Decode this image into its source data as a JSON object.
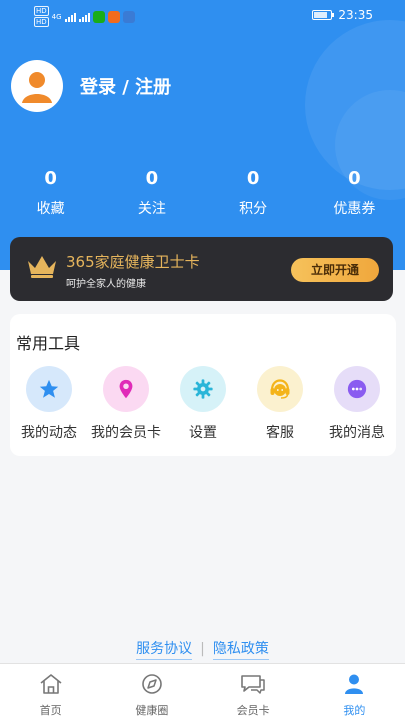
{
  "status_bar": {
    "time": "23:35",
    "sim_tags": [
      "HD",
      "HD"
    ],
    "network": "4G",
    "app_icons": [
      "wechat-icon",
      "video-icon",
      "browser-icon"
    ],
    "battery_level": 0.8,
    "colors": {
      "wechat": "#1aad19",
      "video": "#f26b1d",
      "browser": "#3a7bd5"
    }
  },
  "user": {
    "login_label": "登录 / 注册"
  },
  "stats": [
    {
      "value": "0",
      "label": "收藏"
    },
    {
      "value": "0",
      "label": "关注"
    },
    {
      "value": "0",
      "label": "积分"
    },
    {
      "value": "0",
      "label": "优惠券"
    }
  ],
  "vip_card": {
    "title": "365家庭健康卫士卡",
    "subtitle": "呵护全家人的健康",
    "button": "立即开通"
  },
  "tools": {
    "heading": "常用工具",
    "items": [
      {
        "label": "我的动态",
        "icon": "star-icon",
        "bg": "#d6e8fb",
        "fg": "#2f8ff0"
      },
      {
        "label": "我的会员卡",
        "icon": "location-pin-icon",
        "bg": "#fbd9f2",
        "fg": "#e02bb8"
      },
      {
        "label": "设置",
        "icon": "gear-icon",
        "bg": "#d6f2f8",
        "fg": "#2ab5d8"
      },
      {
        "label": "客服",
        "icon": "headset-icon",
        "bg": "#fbf1cf",
        "fg": "#f4b41a"
      },
      {
        "label": "我的消息",
        "icon": "message-icon",
        "bg": "#e6ddf8",
        "fg": "#8a5cf0"
      }
    ]
  },
  "footer_links": {
    "service": "服务协议",
    "privacy": "隐私政策"
  },
  "tabbar": [
    {
      "label": "首页",
      "icon": "home-icon",
      "active": false
    },
    {
      "label": "健康圈",
      "icon": "compass-icon",
      "active": false
    },
    {
      "label": "会员卡",
      "icon": "chat-icon",
      "active": false
    },
    {
      "label": "我的",
      "icon": "user-icon",
      "active": true
    }
  ],
  "colors": {
    "brand": "#2f8ff0",
    "gold": "#e6b55c",
    "dark_card": "#2c2c30"
  }
}
